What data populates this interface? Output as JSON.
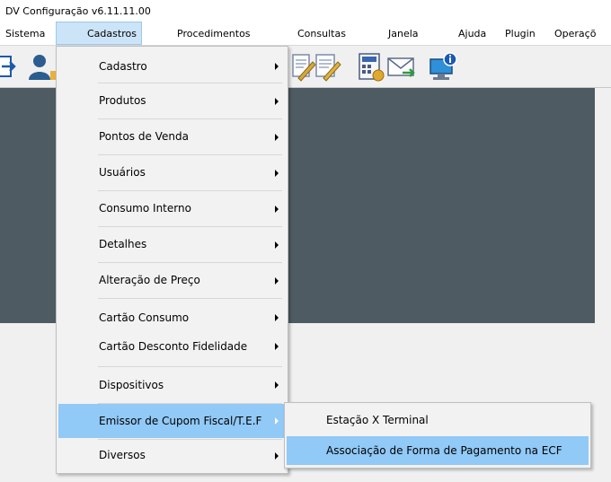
{
  "window": {
    "title": "DV Configuração v6.11.11.00"
  },
  "menubar": {
    "items": [
      "Sistema",
      "Cadastros",
      "Procedimentos",
      "Consultas",
      "Janela",
      "Ajuda",
      "Plugin",
      "Operaçõ"
    ],
    "active": "Cadastros"
  },
  "toolbar": {
    "icons": [
      "exit-icon",
      "user-icon",
      "edit-report-icon",
      "edit-report-icon",
      "calculator-icon",
      "mail-send-icon",
      "computer-info-icon"
    ]
  },
  "cadastros_menu": {
    "items": [
      {
        "label": "Cadastro",
        "submenu": true
      },
      {
        "label": "Produtos",
        "submenu": true
      },
      {
        "label": "Pontos de Venda",
        "submenu": true
      },
      {
        "label": "Usuários",
        "submenu": true
      },
      {
        "label": "Consumo Interno",
        "submenu": true
      },
      {
        "label": "Detalhes",
        "submenu": true
      },
      {
        "label": "Alteração de Preço",
        "submenu": true
      },
      {
        "label": "Cartão Consumo",
        "submenu": true
      },
      {
        "label": "Cartão Desconto Fidelidade",
        "submenu": true
      },
      {
        "label": "Dispositivos",
        "submenu": true
      },
      {
        "label": "Emissor de Cupom Fiscal/T.E.F",
        "submenu": true,
        "highlighted": true
      },
      {
        "label": "Diversos",
        "submenu": true
      }
    ]
  },
  "submenu_emissor": {
    "items": [
      {
        "label": "Estação X Terminal"
      },
      {
        "label": "Associação de Forma de Pagamento na ECF",
        "highlighted": true
      }
    ]
  },
  "colors": {
    "menu_highlight": "#91c9f7",
    "menubar_active": "#cce4f7",
    "workarea": "#4f5b62"
  }
}
